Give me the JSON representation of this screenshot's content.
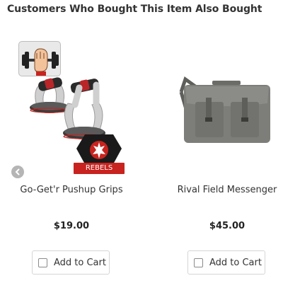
{
  "section": {
    "title": "Customers Who Bought This Item Also Bought"
  },
  "products": [
    {
      "name": "Go-Get'r Pushup Grips",
      "price": "$19.00",
      "add_to_cart_label": "Add to Cart",
      "overlay_icon": "dumbbell-fist-icon",
      "badge": {
        "icon": "rebel-alliance-icon",
        "label": "REBELS"
      }
    },
    {
      "name": "Rival Field Messenger",
      "price": "$45.00",
      "add_to_cart_label": "Add to Cart"
    }
  ],
  "controls": {
    "prev_icon": "chevron-left-icon"
  },
  "colors": {
    "badge_red": "#c8231f",
    "arrow_gray": "#b5b5b5",
    "bag_gray": "#7d7e79"
  }
}
